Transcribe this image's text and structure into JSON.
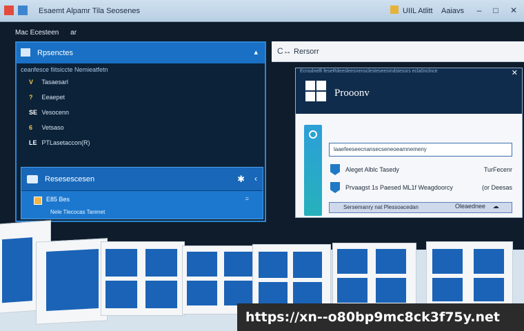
{
  "titlebar": {
    "menu_label": "Esaemt",
    "app_title": "Alpamr Tila Seosenes",
    "tray_label": "UIIL Atlitt",
    "user_label": "Aaiavs"
  },
  "desktop": {
    "label": "Mac Ecesteen",
    "label_suffix": "ar"
  },
  "left_panel": {
    "header": "Rpsenctes",
    "subheader": "ceanfesce fiitsiccte Nemieatfetn",
    "tree_items": [
      {
        "icon": "V",
        "label": "Tasaesarl"
      },
      {
        "icon": "?",
        "label": "Eeaepet"
      },
      {
        "icon": "SE",
        "label": "Vesocenn"
      },
      {
        "icon": "6",
        "label": "Vetsaso"
      },
      {
        "icon": "LE",
        "label": "PTLasetaccon(R)"
      }
    ],
    "sub_panel": {
      "title": "Resesescesen",
      "row_label": "E85 Bes",
      "row_mark": "=",
      "footer": "Nele Tlecocas Tarenet"
    }
  },
  "right_header": {
    "icon": "C↔",
    "title": "Rersorr"
  },
  "dialog": {
    "crumb": "Ecnsdnelfi feseRdeesleesnensclesteseesmdstessrs ecla0nclnce",
    "title": "Prooonv",
    "search_text": "laaefeeseecnansecseneoeamnemeny",
    "options": [
      {
        "label": "Aleget Alblc Tasedy",
        "value": "TurFecenr"
      },
      {
        "label": "Prvaagst 1s Paesed ML1f Weagdoorcy",
        "value": "(or Deesas"
      }
    ],
    "selected": "Sersemanry nat Plessoacedan",
    "footer": "Oleaednee"
  },
  "url": "https://xn--o80bp9mc8ck3f75y.net"
}
